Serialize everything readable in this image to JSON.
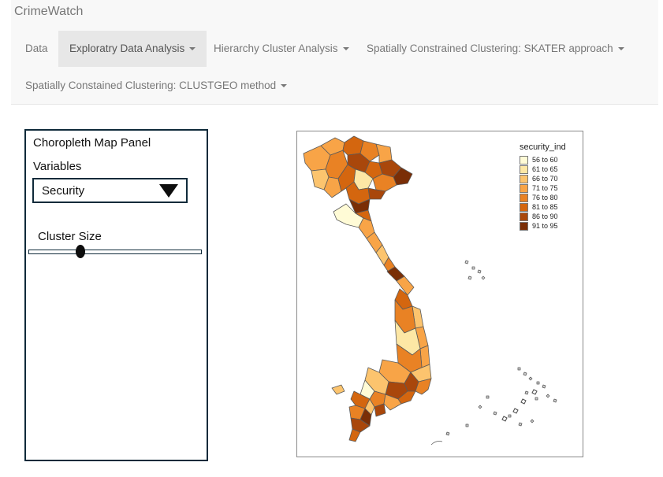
{
  "app": {
    "title": "CrimeWatch"
  },
  "nav": {
    "items": [
      {
        "label": "Data",
        "dropdown": false
      },
      {
        "label": "Exploratry Data Analysis",
        "dropdown": true,
        "active": true
      },
      {
        "label": "Hierarchy Cluster Analysis",
        "dropdown": true
      },
      {
        "label": "Spatially Constrained Clustering: SKATER approach",
        "dropdown": true
      },
      {
        "label": "Spatially Constained Clustering: CLUSTGEO method",
        "dropdown": true
      }
    ]
  },
  "panel": {
    "title": "Choropleth Map Panel",
    "variables_label": "Variables",
    "variables_selected": "Security",
    "cluster_size_label": "Cluster Size",
    "cluster_size_value": 0.3
  },
  "map": {
    "legend": {
      "title": "security_ind",
      "items": [
        {
          "label": "56 to 60",
          "color": "#fffbd6"
        },
        {
          "label": "61 to 65",
          "color": "#fde7a5"
        },
        {
          "label": "66 to 70",
          "color": "#fcc46e"
        },
        {
          "label": "71 to 75",
          "color": "#f8a447"
        },
        {
          "label": "76 to 80",
          "color": "#e98224"
        },
        {
          "label": "81 to 85",
          "color": "#d4660f"
        },
        {
          "label": "86 to 90",
          "color": "#a9470b"
        },
        {
          "label": "91 to 95",
          "color": "#7a2e06"
        }
      ]
    }
  }
}
